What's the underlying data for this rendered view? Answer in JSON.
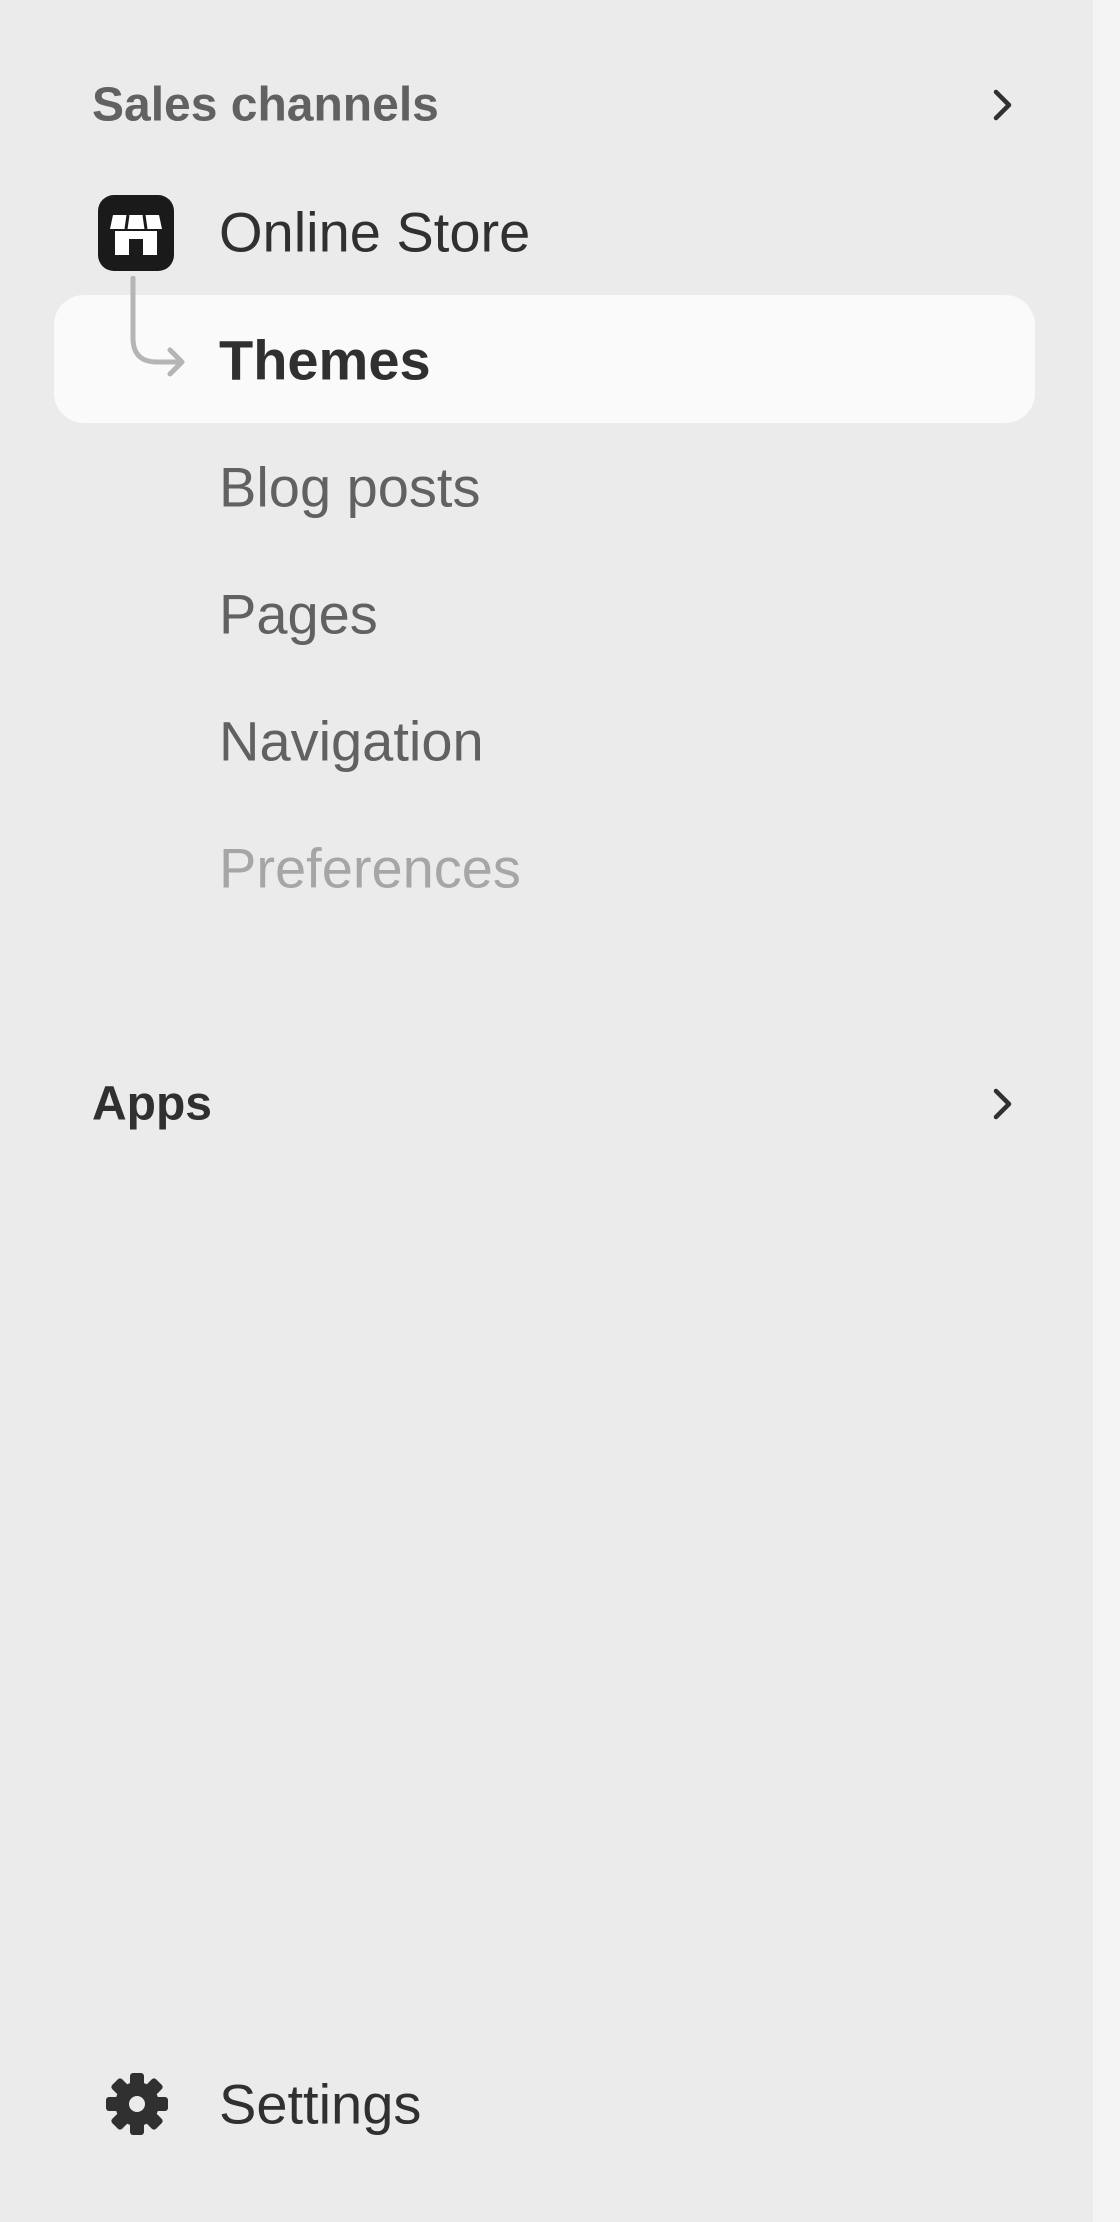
{
  "sales_channels": {
    "title": "Sales channels",
    "online_store": {
      "label": "Online Store",
      "icon": "store-icon",
      "subitems": [
        {
          "label": "Themes",
          "active": true
        },
        {
          "label": "Blog posts",
          "active": false
        },
        {
          "label": "Pages",
          "active": false
        },
        {
          "label": "Navigation",
          "active": false
        },
        {
          "label": "Preferences",
          "active": false
        }
      ]
    }
  },
  "apps": {
    "title": "Apps"
  },
  "settings": {
    "label": "Settings",
    "icon": "gear-icon"
  },
  "colors": {
    "sidebar_bg": "#ebebeb",
    "active_row_bg": "#fafafa",
    "text_primary": "#303030",
    "text_secondary": "#616161",
    "text_disabled": "#a6a6a6"
  }
}
